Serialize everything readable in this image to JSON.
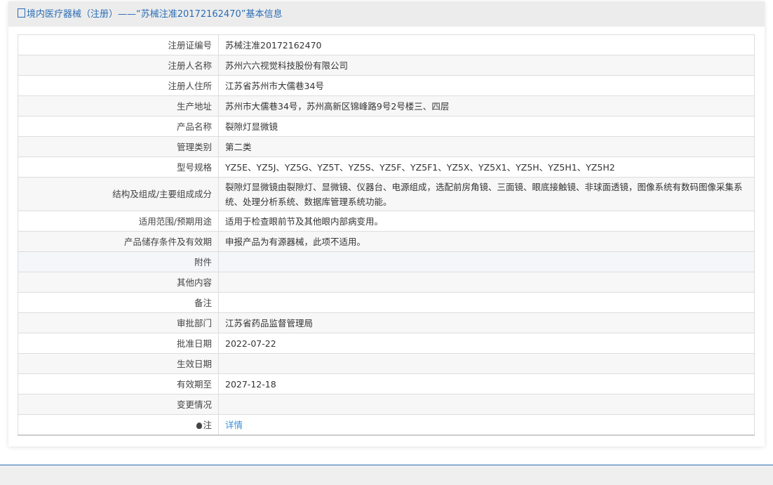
{
  "header": {
    "title": "境内医疗器械（注册）——“苏械注准20172162470”基本信息"
  },
  "rows": [
    {
      "label": "注册证编号",
      "value": "苏械注准20172162470"
    },
    {
      "label": "注册人名称",
      "value": "苏州六六视觉科技股份有限公司"
    },
    {
      "label": "注册人住所",
      "value": "江苏省苏州市大儒巷34号"
    },
    {
      "label": "生产地址",
      "value": "苏州市大儒巷34号，苏州高新区锦峰路9号2号楼三、四层"
    },
    {
      "label": "产品名称",
      "value": "裂隙灯显微镜"
    },
    {
      "label": "管理类别",
      "value": "第二类"
    },
    {
      "label": "型号规格",
      "value": "YZ5E、YZ5J、YZ5G、YZ5T、YZ5S、YZ5F、YZ5F1、YZ5X、YZ5X1、YZ5H、YZ5H1、YZ5H2"
    },
    {
      "label": "结构及组成/主要组成成分",
      "value": "裂隙灯显微镜由裂隙灯、显微镜、仪器台、电源组成，选配前房角镜、三面镜、眼底接触镜、非球面透镜，图像系统有数码图像采集系统、处理分析系统、数据库管理系统功能。"
    },
    {
      "label": "适用范围/预期用途",
      "value": "适用于检查眼前节及其他眼内部病变用。"
    },
    {
      "label": "产品储存条件及有效期",
      "value": "申报产品为有源器械，此项不适用。"
    },
    {
      "label": "附件",
      "value": ""
    },
    {
      "label": "其他内容",
      "value": ""
    },
    {
      "label": "备注",
      "value": ""
    },
    {
      "label": "审批部门",
      "value": "江苏省药品监督管理局"
    },
    {
      "label": "批准日期",
      "value": "2022-07-22"
    },
    {
      "label": "生效日期",
      "value": ""
    },
    {
      "label": "有效期至",
      "value": "2027-12-18"
    },
    {
      "label": "变更情况",
      "value": ""
    }
  ],
  "note": {
    "label": "注",
    "link": "详情"
  }
}
